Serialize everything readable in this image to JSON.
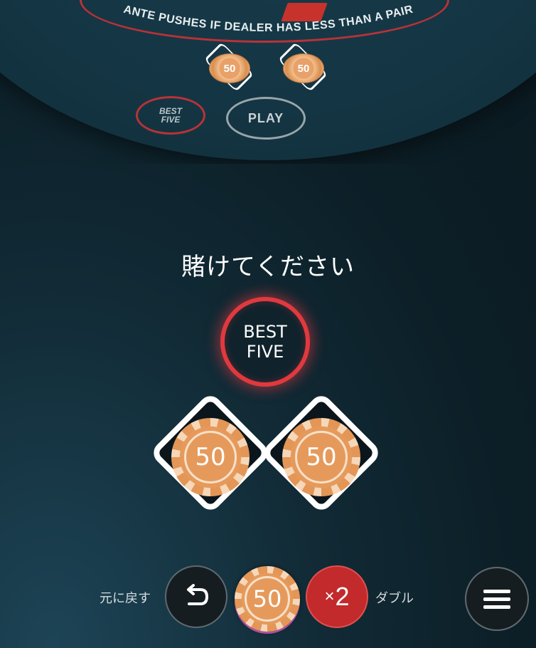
{
  "table": {
    "arc_text": "ANTE PUSHES IF DEALER HAS LESS THAN A PAIR",
    "mini_chip_1": "50",
    "mini_chip_2": "50",
    "mini_best_line1": "BEST",
    "mini_best_line2": "FIVE",
    "mini_play": "PLAY"
  },
  "prompt": "賭けてください",
  "best_five": {
    "line1": "BEST",
    "line2": "FIVE"
  },
  "bets": {
    "left_chip": "50",
    "right_chip": "50"
  },
  "controls": {
    "undo_label": "元に戻す",
    "selected_chip": "50",
    "double_prefix": "×",
    "double_value": "2",
    "double_label": "ダブル"
  },
  "colors": {
    "accent_red": "#e0393f",
    "chip_orange": "#e59a5c",
    "background": "#0c1e26"
  }
}
